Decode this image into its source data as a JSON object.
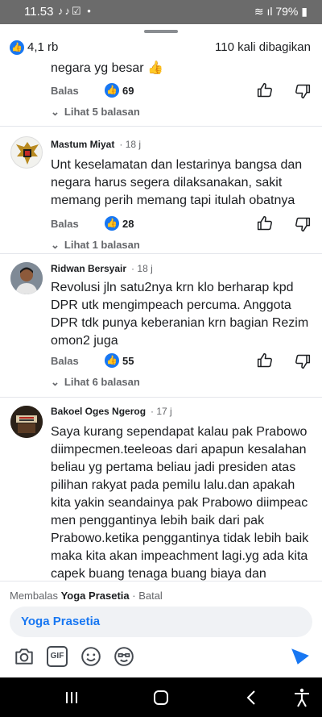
{
  "status": {
    "time": "11.53",
    "battery": "79%"
  },
  "summary": {
    "reactions": "4,1 rb",
    "shares": "110 kali dibagikan"
  },
  "labels": {
    "reply": "Balas"
  },
  "partial": {
    "text": "negara yg besar 👍",
    "likes": "69",
    "replies": "Lihat 5 balasan"
  },
  "comments": [
    {
      "author": "Mastum Miyat",
      "time": "18 j",
      "text": "Unt keselamatan dan lestarinya bangsa dan negara harus segera dilaksanakan, sakit memang perih memang tapi itulah obatnya",
      "likes": "28",
      "replies": "Lihat 1 balasan"
    },
    {
      "author": "Ridwan Bersyair",
      "time": "18 j",
      "text": "Revolusi jln satu2nya krn klo berharap kpd DPR utk mengimpeach percuma. Anggota DPR tdk punya keberanian krn bagian Rezim omon2 juga",
      "likes": "55",
      "replies": "Lihat 6 balasan"
    },
    {
      "author": "Bakoel Oges Ngerog",
      "time": "17 j",
      "text": "Saya kurang sependapat kalau pak Prabowo diimpecmen.teeleoas dari apapun kesalahan beliau yg pertama beliau jadi presiden atas pilihan rakyat pada pemilu lalu.dan apakah kita yakin seandainya pak Prabowo diimpeac men penggantinya lebih baik dari pak Prabowo.ketika penggantinya tidak lebih baik maka kita akan impeachment lagi.yg ada kita capek buang tenaga buang biaya dan akhirnya"
    }
  ],
  "compose": {
    "replying_prefix": "Membalas",
    "replying_name": "Yoga Prasetia",
    "cancel": "· Batal",
    "mention": "Yoga Prasetia",
    "gif": "GIF"
  },
  "colors": {
    "accent": "#1877f2",
    "muted": "#65676b",
    "statusbar": "#6b6b6b"
  },
  "icons": [
    "camera-icon",
    "gif-icon",
    "emoji-icon",
    "sticker-icon",
    "send-icon",
    "thumb-up-icon",
    "thumb-down-icon",
    "chevron-down-icon"
  ]
}
